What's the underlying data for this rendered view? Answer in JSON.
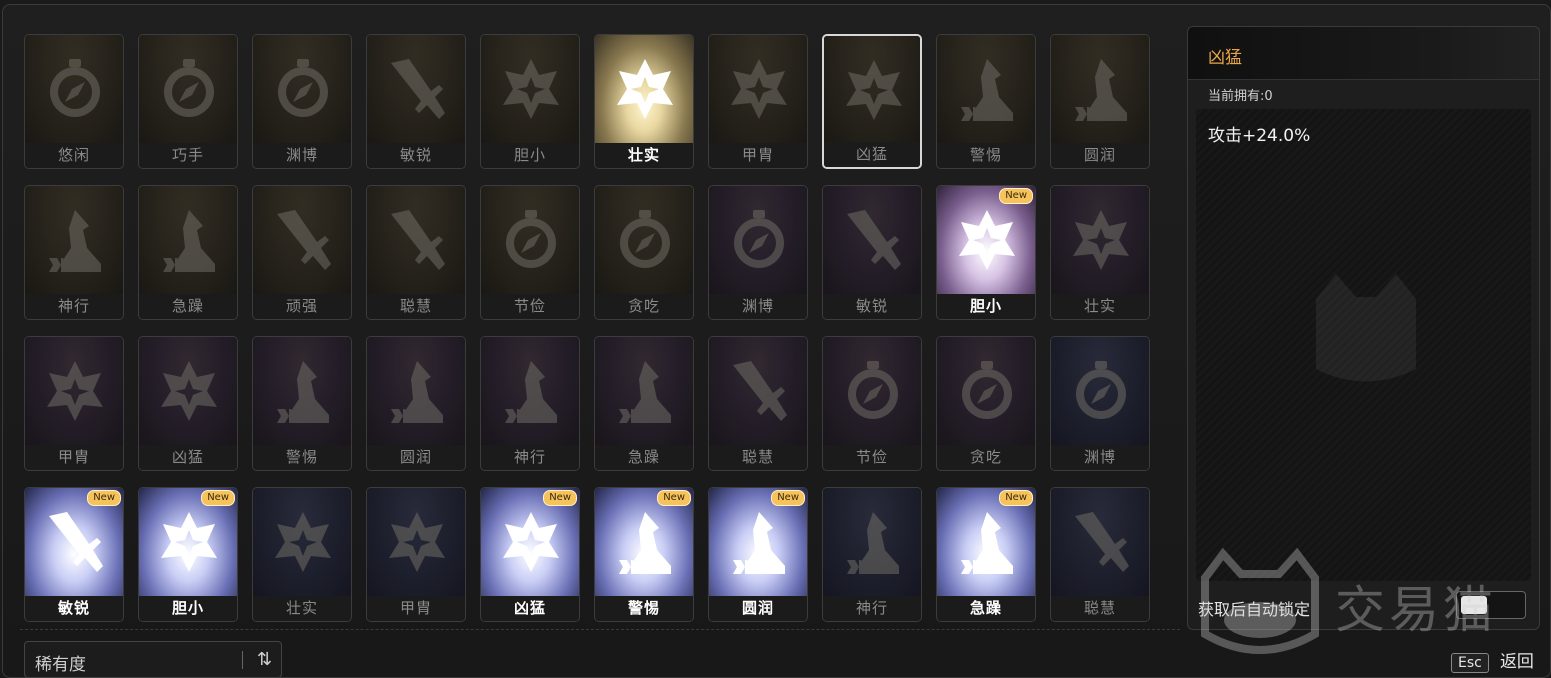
{
  "cards": [
    {
      "name": "悠闲",
      "icon": "compass",
      "tier": "gold",
      "state": "dim",
      "badge": ""
    },
    {
      "name": "巧手",
      "icon": "compass",
      "tier": "gold",
      "state": "dim",
      "badge": ""
    },
    {
      "name": "渊博",
      "icon": "compass",
      "tier": "gold",
      "state": "dim",
      "badge": ""
    },
    {
      "name": "敏锐",
      "icon": "sword",
      "tier": "gold",
      "state": "dim",
      "badge": ""
    },
    {
      "name": "胆小",
      "icon": "star",
      "tier": "gold",
      "state": "dim",
      "badge": ""
    },
    {
      "name": "壮实",
      "icon": "star",
      "tier": "gold",
      "state": "bright",
      "badge": ""
    },
    {
      "name": "甲胄",
      "icon": "star",
      "tier": "gold",
      "state": "dim",
      "badge": ""
    },
    {
      "name": "凶猛",
      "icon": "star",
      "tier": "gold",
      "state": "selected",
      "badge": ""
    },
    {
      "name": "警惕",
      "icon": "boot",
      "tier": "gold",
      "state": "dim",
      "badge": ""
    },
    {
      "name": "圆润",
      "icon": "boot",
      "tier": "gold",
      "state": "dim",
      "badge": ""
    },
    {
      "name": "神行",
      "icon": "boot",
      "tier": "gold",
      "state": "dim",
      "badge": ""
    },
    {
      "name": "急躁",
      "icon": "boot",
      "tier": "gold",
      "state": "dim",
      "badge": ""
    },
    {
      "name": "顽强",
      "icon": "sword",
      "tier": "gold",
      "state": "dim",
      "badge": ""
    },
    {
      "name": "聪慧",
      "icon": "sword",
      "tier": "gold",
      "state": "dim",
      "badge": ""
    },
    {
      "name": "节俭",
      "icon": "compass",
      "tier": "gold",
      "state": "dim",
      "badge": ""
    },
    {
      "name": "贪吃",
      "icon": "compass",
      "tier": "gold",
      "state": "dim",
      "badge": ""
    },
    {
      "name": "渊博",
      "icon": "compass",
      "tier": "purple",
      "state": "dim",
      "badge": ""
    },
    {
      "name": "敏锐",
      "icon": "sword",
      "tier": "purple",
      "state": "dim",
      "badge": ""
    },
    {
      "name": "胆小",
      "icon": "star",
      "tier": "purple",
      "state": "bright",
      "badge": "New"
    },
    {
      "name": "壮实",
      "icon": "star",
      "tier": "purple",
      "state": "dim",
      "badge": ""
    },
    {
      "name": "甲胄",
      "icon": "star",
      "tier": "purple",
      "state": "dim",
      "badge": ""
    },
    {
      "name": "凶猛",
      "icon": "star",
      "tier": "purple",
      "state": "dim",
      "badge": ""
    },
    {
      "name": "警惕",
      "icon": "boot",
      "tier": "purple",
      "state": "dim",
      "badge": ""
    },
    {
      "name": "圆润",
      "icon": "boot",
      "tier": "purple",
      "state": "dim",
      "badge": ""
    },
    {
      "name": "神行",
      "icon": "boot",
      "tier": "purple",
      "state": "dim",
      "badge": ""
    },
    {
      "name": "急躁",
      "icon": "boot",
      "tier": "purple",
      "state": "dim",
      "badge": ""
    },
    {
      "name": "聪慧",
      "icon": "sword",
      "tier": "purple",
      "state": "dim",
      "badge": ""
    },
    {
      "name": "节俭",
      "icon": "compass",
      "tier": "purple",
      "state": "dim",
      "badge": ""
    },
    {
      "name": "贪吃",
      "icon": "compass",
      "tier": "purple",
      "state": "dim",
      "badge": ""
    },
    {
      "name": "渊博",
      "icon": "compass",
      "tier": "blue",
      "state": "dim",
      "badge": ""
    },
    {
      "name": "敏锐",
      "icon": "sword",
      "tier": "blue",
      "state": "bright",
      "badge": "New"
    },
    {
      "name": "胆小",
      "icon": "star",
      "tier": "blue",
      "state": "bright",
      "badge": "New"
    },
    {
      "name": "壮实",
      "icon": "star",
      "tier": "blue",
      "state": "dim",
      "badge": ""
    },
    {
      "name": "甲胄",
      "icon": "star",
      "tier": "blue",
      "state": "dim",
      "badge": ""
    },
    {
      "name": "凶猛",
      "icon": "star",
      "tier": "blue",
      "state": "bright",
      "badge": "New"
    },
    {
      "name": "警惕",
      "icon": "boot",
      "tier": "blue",
      "state": "bright",
      "badge": "New"
    },
    {
      "name": "圆润",
      "icon": "boot",
      "tier": "blue",
      "state": "bright",
      "badge": "New"
    },
    {
      "name": "神行",
      "icon": "boot",
      "tier": "blue",
      "state": "dim",
      "badge": ""
    },
    {
      "name": "急躁",
      "icon": "boot",
      "tier": "blue",
      "state": "bright",
      "badge": "New"
    },
    {
      "name": "聪慧",
      "icon": "sword",
      "tier": "blue",
      "state": "dim",
      "badge": ""
    }
  ],
  "sort": {
    "label": "稀有度",
    "icon": "sort-arrows-icon",
    "icon_glyph": "⇅"
  },
  "detail": {
    "title": "凶猛",
    "owned": "当前拥有:0",
    "effect": "攻击+24.0%",
    "auto_lock_label": "获取后自动锁定"
  },
  "footer": {
    "esc_key": "Esc",
    "back_label": "返回"
  },
  "watermark": {
    "text": "交易猫"
  },
  "colors": {
    "accent": "#e8a64a",
    "badge": "#f6c35a"
  }
}
